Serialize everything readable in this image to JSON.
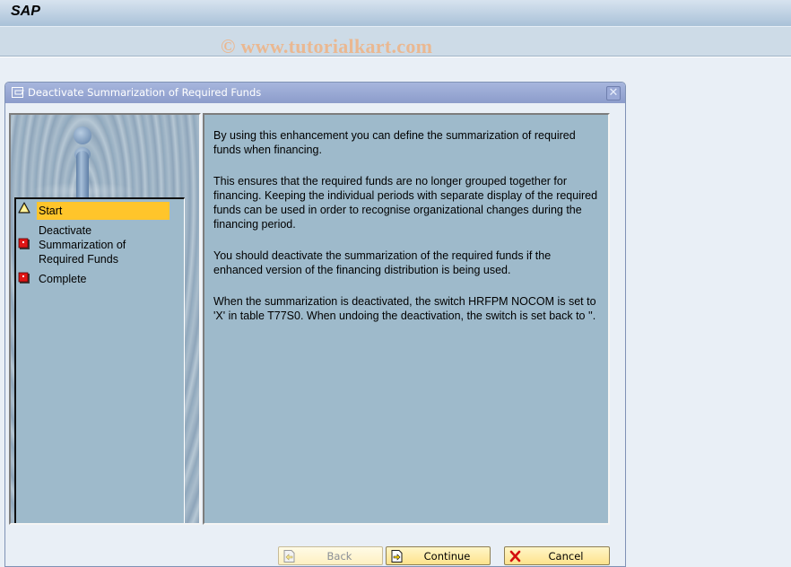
{
  "app": {
    "logo": "SAP",
    "watermark": "© www.tutorialkart.com"
  },
  "dialog": {
    "title": "Deactivate Summarization of Required Funds",
    "close_label": "✕",
    "steps": [
      {
        "label": "Start",
        "status": "current",
        "icon": "warning-triangle-icon"
      },
      {
        "label": "Deactivate Summarization of Required Funds",
        "status": "pending",
        "icon": "red-square-icon"
      },
      {
        "label": "Complete",
        "status": "pending",
        "icon": "red-square-icon"
      }
    ],
    "paragraphs": [
      "By using this enhancement you can define the summarization of required funds when financing.",
      "This ensures that the required funds are no longer grouped together for financing. Keeping the individual periods with separate display of the required funds can be used in order to recognise organizational changes during the financing period.",
      "You should deactivate the summarization of the required funds if the enhanced version of the financing distribution is being used.",
      "When the summarization is deactivated, the switch HRFPM NOCOM is set to 'X' in table T77S0. When undoing the deactivation, the switch is set back to ''."
    ],
    "buttons": {
      "back": {
        "label": "Back",
        "enabled": false
      },
      "continue": {
        "label": "Continue",
        "enabled": true
      },
      "cancel": {
        "label": "Cancel",
        "enabled": true
      }
    }
  },
  "colors": {
    "active_step": "#ffc52b",
    "panel_bg": "#9ebacb",
    "title_bar": "#9aa9d6"
  }
}
